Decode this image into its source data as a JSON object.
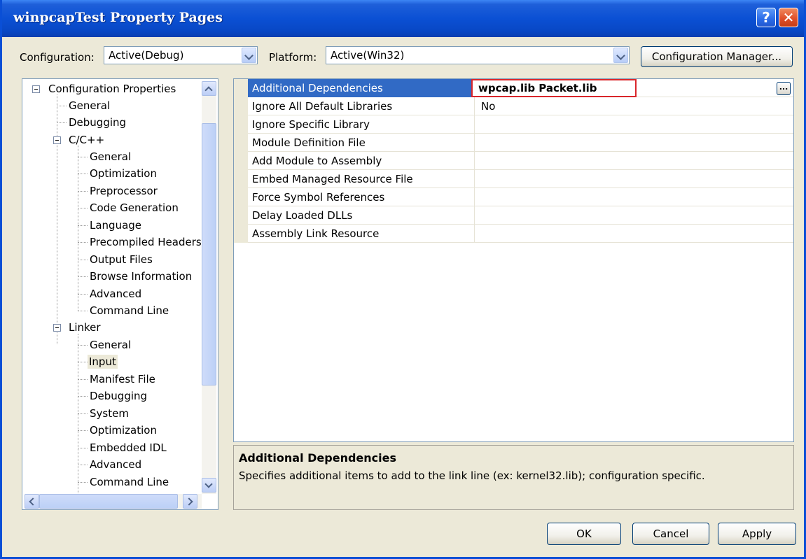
{
  "window": {
    "title": "winpcapTest Property Pages"
  },
  "title_buttons": {
    "help": "?",
    "close": "✕"
  },
  "config_bar": {
    "configuration_label": "Configuration:",
    "configuration_value": "Active(Debug)",
    "platform_label": "Platform:",
    "platform_value": "Active(Win32)",
    "manager_button": "Configuration Manager..."
  },
  "tree": {
    "root": "Configuration Properties",
    "general": "General",
    "debugging": "Debugging",
    "cpp": {
      "label": "C/C++",
      "children": [
        "General",
        "Optimization",
        "Preprocessor",
        "Code Generation",
        "Language",
        "Precompiled Headers",
        "Output Files",
        "Browse Information",
        "Advanced",
        "Command Line"
      ]
    },
    "linker": {
      "label": "Linker",
      "children": [
        "General",
        "Input",
        "Manifest File",
        "Debugging",
        "System",
        "Optimization",
        "Embedded IDL",
        "Advanced",
        "Command Line"
      ],
      "selected": "Input"
    }
  },
  "properties": [
    {
      "name": "Additional Dependencies",
      "value": "wpcap.lib Packet.lib"
    },
    {
      "name": "Ignore All Default Libraries",
      "value": "No"
    },
    {
      "name": "Ignore Specific Library",
      "value": ""
    },
    {
      "name": "Module Definition File",
      "value": ""
    },
    {
      "name": "Add Module to Assembly",
      "value": ""
    },
    {
      "name": "Embed Managed Resource File",
      "value": ""
    },
    {
      "name": "Force Symbol References",
      "value": ""
    },
    {
      "name": "Delay Loaded DLLs",
      "value": ""
    },
    {
      "name": "Assembly Link Resource",
      "value": ""
    }
  ],
  "ellipsis_button": "...",
  "description": {
    "title": "Additional Dependencies",
    "text": "Specifies additional items to add to the link line (ex: kernel32.lib); configuration specific."
  },
  "buttons": {
    "ok": "OK",
    "cancel": "Cancel",
    "apply": "Apply"
  },
  "colors": {
    "titlebar": "#0b50d4",
    "selection": "#316ac5",
    "highlight_border": "#d9262b",
    "dialog_bg": "#ece9d8"
  }
}
